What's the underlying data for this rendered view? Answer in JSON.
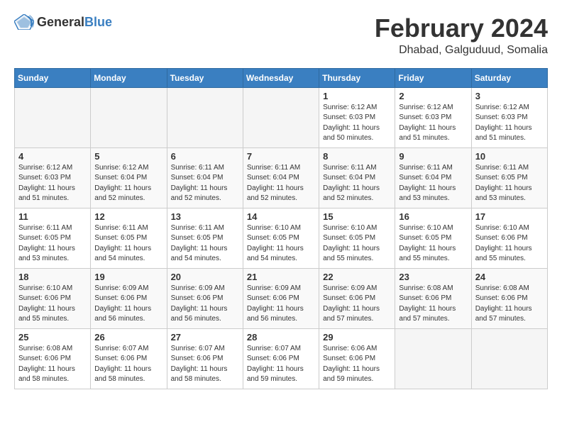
{
  "header": {
    "logo_general": "General",
    "logo_blue": "Blue",
    "month_year": "February 2024",
    "location": "Dhabad, Galguduud, Somalia"
  },
  "weekdays": [
    "Sunday",
    "Monday",
    "Tuesday",
    "Wednesday",
    "Thursday",
    "Friday",
    "Saturday"
  ],
  "weeks": [
    [
      {
        "day": "",
        "info": ""
      },
      {
        "day": "",
        "info": ""
      },
      {
        "day": "",
        "info": ""
      },
      {
        "day": "",
        "info": ""
      },
      {
        "day": "1",
        "info": "Sunrise: 6:12 AM\nSunset: 6:03 PM\nDaylight: 11 hours\nand 50 minutes."
      },
      {
        "day": "2",
        "info": "Sunrise: 6:12 AM\nSunset: 6:03 PM\nDaylight: 11 hours\nand 51 minutes."
      },
      {
        "day": "3",
        "info": "Sunrise: 6:12 AM\nSunset: 6:03 PM\nDaylight: 11 hours\nand 51 minutes."
      }
    ],
    [
      {
        "day": "4",
        "info": "Sunrise: 6:12 AM\nSunset: 6:03 PM\nDaylight: 11 hours\nand 51 minutes."
      },
      {
        "day": "5",
        "info": "Sunrise: 6:12 AM\nSunset: 6:04 PM\nDaylight: 11 hours\nand 52 minutes."
      },
      {
        "day": "6",
        "info": "Sunrise: 6:11 AM\nSunset: 6:04 PM\nDaylight: 11 hours\nand 52 minutes."
      },
      {
        "day": "7",
        "info": "Sunrise: 6:11 AM\nSunset: 6:04 PM\nDaylight: 11 hours\nand 52 minutes."
      },
      {
        "day": "8",
        "info": "Sunrise: 6:11 AM\nSunset: 6:04 PM\nDaylight: 11 hours\nand 52 minutes."
      },
      {
        "day": "9",
        "info": "Sunrise: 6:11 AM\nSunset: 6:04 PM\nDaylight: 11 hours\nand 53 minutes."
      },
      {
        "day": "10",
        "info": "Sunrise: 6:11 AM\nSunset: 6:05 PM\nDaylight: 11 hours\nand 53 minutes."
      }
    ],
    [
      {
        "day": "11",
        "info": "Sunrise: 6:11 AM\nSunset: 6:05 PM\nDaylight: 11 hours\nand 53 minutes."
      },
      {
        "day": "12",
        "info": "Sunrise: 6:11 AM\nSunset: 6:05 PM\nDaylight: 11 hours\nand 54 minutes."
      },
      {
        "day": "13",
        "info": "Sunrise: 6:11 AM\nSunset: 6:05 PM\nDaylight: 11 hours\nand 54 minutes."
      },
      {
        "day": "14",
        "info": "Sunrise: 6:10 AM\nSunset: 6:05 PM\nDaylight: 11 hours\nand 54 minutes."
      },
      {
        "day": "15",
        "info": "Sunrise: 6:10 AM\nSunset: 6:05 PM\nDaylight: 11 hours\nand 55 minutes."
      },
      {
        "day": "16",
        "info": "Sunrise: 6:10 AM\nSunset: 6:05 PM\nDaylight: 11 hours\nand 55 minutes."
      },
      {
        "day": "17",
        "info": "Sunrise: 6:10 AM\nSunset: 6:06 PM\nDaylight: 11 hours\nand 55 minutes."
      }
    ],
    [
      {
        "day": "18",
        "info": "Sunrise: 6:10 AM\nSunset: 6:06 PM\nDaylight: 11 hours\nand 55 minutes."
      },
      {
        "day": "19",
        "info": "Sunrise: 6:09 AM\nSunset: 6:06 PM\nDaylight: 11 hours\nand 56 minutes."
      },
      {
        "day": "20",
        "info": "Sunrise: 6:09 AM\nSunset: 6:06 PM\nDaylight: 11 hours\nand 56 minutes."
      },
      {
        "day": "21",
        "info": "Sunrise: 6:09 AM\nSunset: 6:06 PM\nDaylight: 11 hours\nand 56 minutes."
      },
      {
        "day": "22",
        "info": "Sunrise: 6:09 AM\nSunset: 6:06 PM\nDaylight: 11 hours\nand 57 minutes."
      },
      {
        "day": "23",
        "info": "Sunrise: 6:08 AM\nSunset: 6:06 PM\nDaylight: 11 hours\nand 57 minutes."
      },
      {
        "day": "24",
        "info": "Sunrise: 6:08 AM\nSunset: 6:06 PM\nDaylight: 11 hours\nand 57 minutes."
      }
    ],
    [
      {
        "day": "25",
        "info": "Sunrise: 6:08 AM\nSunset: 6:06 PM\nDaylight: 11 hours\nand 58 minutes."
      },
      {
        "day": "26",
        "info": "Sunrise: 6:07 AM\nSunset: 6:06 PM\nDaylight: 11 hours\nand 58 minutes."
      },
      {
        "day": "27",
        "info": "Sunrise: 6:07 AM\nSunset: 6:06 PM\nDaylight: 11 hours\nand 58 minutes."
      },
      {
        "day": "28",
        "info": "Sunrise: 6:07 AM\nSunset: 6:06 PM\nDaylight: 11 hours\nand 59 minutes."
      },
      {
        "day": "29",
        "info": "Sunrise: 6:06 AM\nSunset: 6:06 PM\nDaylight: 11 hours\nand 59 minutes."
      },
      {
        "day": "",
        "info": ""
      },
      {
        "day": "",
        "info": ""
      }
    ]
  ]
}
